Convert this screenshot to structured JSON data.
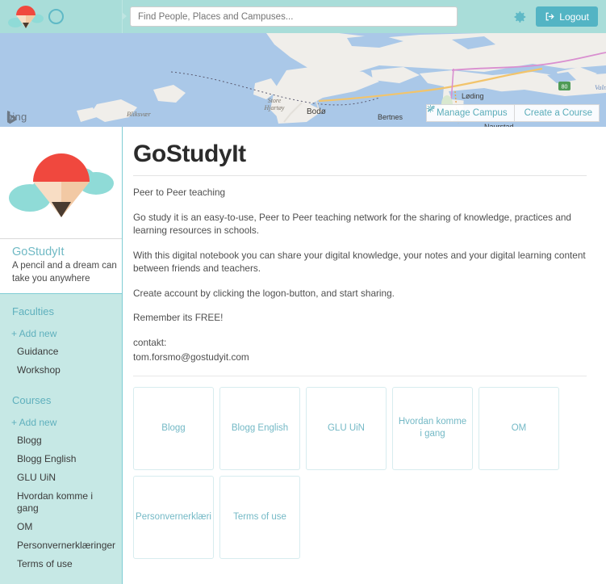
{
  "topbar": {
    "logo_icon": "pencil-cloud-logo",
    "avatar_icon": "avatar-circle-icon",
    "search": {
      "placeholder": "Find People, Places and Campuses...",
      "value": ""
    },
    "settings_icon": "gear-icon",
    "logout_label": "Logout",
    "logout_icon": "sign-out-icon"
  },
  "map": {
    "provider_label": "bing",
    "provider_icon": "bing-logo-icon",
    "labels": [
      "Bliksvær",
      "Store Hjartøy",
      "Bodø",
      "Bertnes",
      "Løding",
      "Naurstad",
      "Valn"
    ],
    "route_shield": "80",
    "buttons": [
      {
        "label": "Manage Campus",
        "icon": "wrench-icon"
      },
      {
        "label": "Create a Course",
        "icon": "gear-outline-icon"
      }
    ]
  },
  "sidebar": {
    "logo_icon": "pencil-cloud-logo-large",
    "title": "GoStudyIt",
    "tagline": "A pencil and a dream can take you anywhere",
    "sections": [
      {
        "title": "Faculties",
        "add_label": "+ Add new",
        "items": [
          "Guidance",
          "Workshop"
        ]
      },
      {
        "title": "Courses",
        "add_label": "+ Add new",
        "items": [
          "Blogg",
          "Blogg English",
          "GLU UiN",
          "Hvordan komme i gang",
          "OM",
          "Personvernerklæringer",
          "Terms of use"
        ]
      }
    ]
  },
  "main": {
    "title": "GoStudyIt",
    "subtitle": "Peer to Peer teaching",
    "paragraphs": [
      "Go study it is an easy-to-use, Peer to Peer teaching network for the sharing of knowledge, practices and learning resources in schools.",
      "With this digital notebook you can share your digital knowledge, your notes and your digital learning content between friends and teachers.",
      "Create account by clicking the logon-button, and start sharing.",
      "Remember its FREE!"
    ],
    "contact_label": "contakt:",
    "contact_email": "tom.forsmo@gostudyit.com",
    "cards": [
      "Blogg",
      "Blogg English",
      "GLU UiN",
      "Hvordan komme i gang",
      "OM",
      "Personvernerklæri",
      "Terms of use"
    ]
  },
  "colors": {
    "topbar_bg": "#a9ddd9",
    "sidebar_bg": "#c6e8e5",
    "accent": "#53b4c4",
    "link": "#5fb0bd",
    "card_border": "#d7ecef",
    "map_water": "#aac8e8",
    "map_land": "#f0eeea",
    "logo_red": "#f0483e",
    "logo_cloud": "#8fdbd7"
  }
}
